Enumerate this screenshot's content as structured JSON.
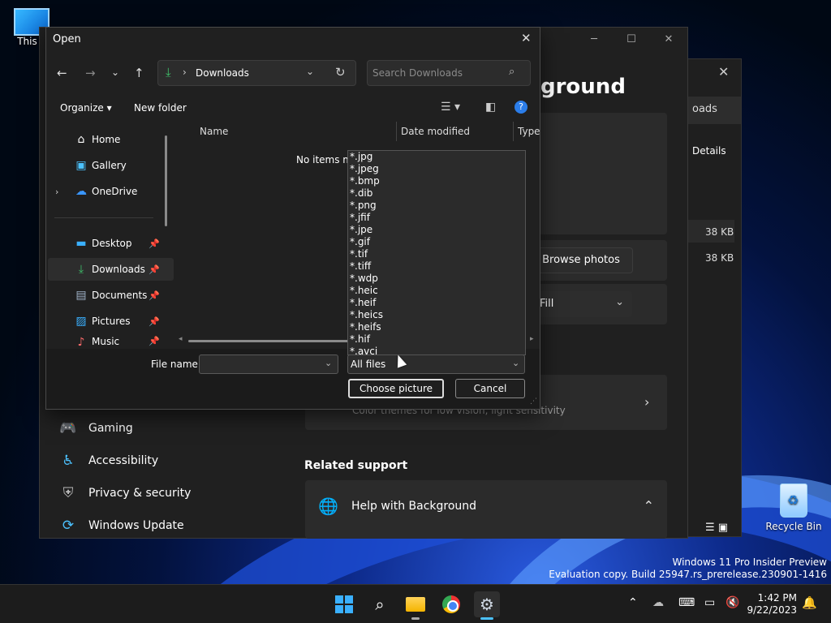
{
  "desktop": {
    "icons": [
      {
        "label": "This P"
      },
      {
        "label": "Recycle Bin"
      }
    ],
    "watermark": {
      "line1": "Windows 11 Pro Insider Preview",
      "line2": "Evaluation copy. Build 25947.rs_prerelease.230901-1416"
    }
  },
  "explorer_bg": {
    "close": "✕",
    "tab_label": "oads",
    "details_label": "Details",
    "col_fragment": "e",
    "sizes": [
      "38 KB",
      "38 KB"
    ]
  },
  "settings_bg": {
    "title": "ground",
    "browse_button": "Browse photos",
    "fit_value": "Fill",
    "nav": [
      {
        "label": "Gaming",
        "icon": "gamepad-icon"
      },
      {
        "label": "Accessibility",
        "icon": "accessibility-icon"
      },
      {
        "label": "Privacy & security",
        "icon": "shield-icon"
      },
      {
        "label": "Windows Update",
        "icon": "update-icon"
      }
    ],
    "contrast_desc": "Color themes for low vision, light sensitivity",
    "related_support": "Related support",
    "help_item": "Help with Background"
  },
  "dialog": {
    "title": "Open",
    "address": {
      "folder": "Downloads"
    },
    "search": {
      "placeholder": "Search Downloads"
    },
    "commands": {
      "organize": "Organize ▾",
      "new_folder": "New folder"
    },
    "sidebar": [
      {
        "label": "Home",
        "icon": "home-icon",
        "pinned": false,
        "selected": false
      },
      {
        "label": "Gallery",
        "icon": "gallery-icon",
        "pinned": false,
        "selected": false
      },
      {
        "label": "OneDrive",
        "icon": "cloud-icon",
        "pinned": false,
        "selected": false,
        "expandable": true
      },
      {
        "label": "Desktop",
        "icon": "desktop-icon",
        "pinned": true,
        "selected": false
      },
      {
        "label": "Downloads",
        "icon": "download-icon",
        "pinned": true,
        "selected": true
      },
      {
        "label": "Documents",
        "icon": "documents-icon",
        "pinned": true,
        "selected": false
      },
      {
        "label": "Pictures",
        "icon": "pictures-icon",
        "pinned": true,
        "selected": false
      },
      {
        "label": "Music",
        "icon": "music-icon",
        "pinned": true,
        "selected": false
      }
    ],
    "columns": [
      "Name",
      "Date modified",
      "Type"
    ],
    "empty_message": "No items ma",
    "file_name_label": "File name:",
    "file_name_value": "",
    "file_type_selected": "All files",
    "file_type_options": [
      "*.jpg",
      "*.jpeg",
      "*.bmp",
      "*.dib",
      "*.png",
      "*.jfif",
      "*.jpe",
      "*.gif",
      "*.tif",
      "*.tiff",
      "*.wdp",
      "*.heic",
      "*.heif",
      "*.heics",
      "*.heifs",
      "*.hif",
      "*.avci"
    ],
    "buttons": {
      "choose": "Choose picture",
      "cancel": "Cancel"
    }
  },
  "taskbar": {
    "apps": [
      "start-icon",
      "search-icon",
      "file-explorer-icon",
      "chrome-icon",
      "settings-icon"
    ],
    "clock": {
      "time": "1:42 PM",
      "date": "9/22/2023"
    }
  }
}
